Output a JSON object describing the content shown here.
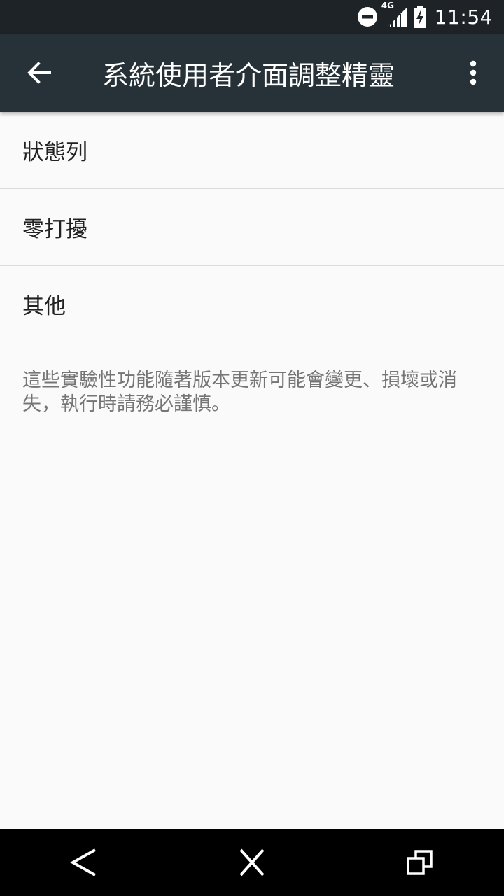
{
  "status_bar": {
    "network_type": "4G",
    "time": "11:54",
    "icons": [
      "do-not-disturb-icon",
      "signal-icon",
      "battery-charging-icon"
    ]
  },
  "app_bar": {
    "title": "系統使用者介面調整精靈",
    "back_icon": "arrow-left-icon",
    "menu_icon": "more-vertical-icon"
  },
  "items": [
    {
      "label": "狀態列"
    },
    {
      "label": "零打擾"
    },
    {
      "label": "其他"
    }
  ],
  "footer_note": "這些實驗性功能隨著版本更新可能會變更、損壞或消失，執行時請務必謹慎。",
  "nav_bar": {
    "icons": [
      "nav-back-icon",
      "nav-home-icon",
      "nav-recents-icon"
    ]
  },
  "colors": {
    "status_bar": "#1d2327",
    "app_bar": "#263238",
    "background": "#fafafa",
    "primary_text": "#212121",
    "secondary_text": "#757575"
  }
}
